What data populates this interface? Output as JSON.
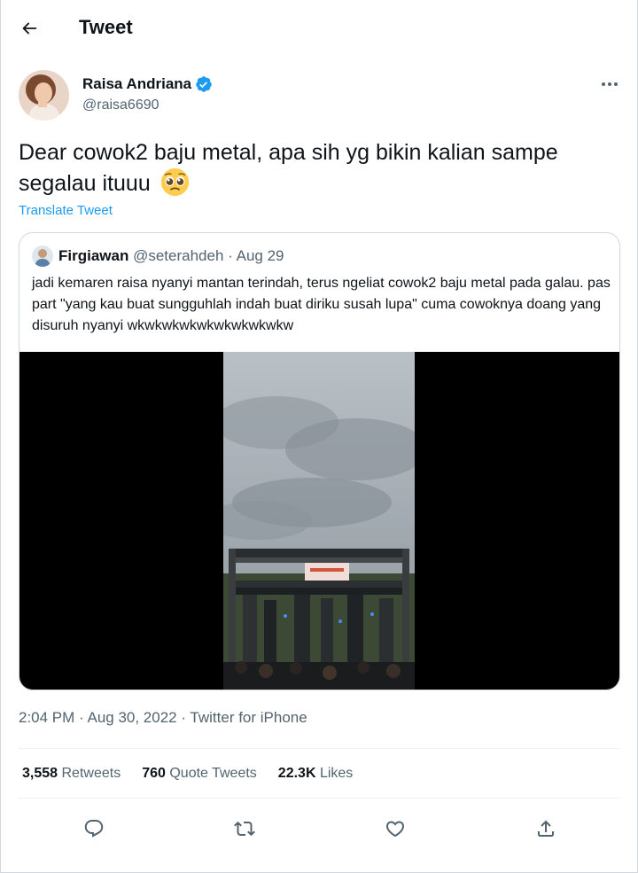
{
  "header": {
    "title": "Tweet"
  },
  "author": {
    "name": "Raisa Andriana",
    "handle": "@raisa6690",
    "verified": true
  },
  "tweet": {
    "text": "Dear cowok2 baju metal, apa sih yg bikin kalian sampe segalau ituuu",
    "emoji": "pleading-face-emoji",
    "translate_label": "Translate Tweet"
  },
  "quoted": {
    "name": "Firgiawan",
    "handle": "@seterahdeh",
    "separator": "·",
    "date": "Aug 29",
    "text": "jadi kemaren raisa nyanyi mantan terindah, terus ngeliat cowok2 baju metal pada galau. pas part \"yang kau buat sungguhlah indah buat diriku susah lupa\" cuma cowoknya doang yang disuruh nyanyi wkwkwkwkwkwkwkwkwkw"
  },
  "meta": {
    "timestamp": "2:04 PM · Aug 30, 2022 · Twitter for iPhone"
  },
  "stats": [
    {
      "count": "3,558",
      "label": "Retweets"
    },
    {
      "count": "760",
      "label": "Quote Tweets"
    },
    {
      "count": "22.3K",
      "label": "Likes"
    }
  ],
  "icons": {
    "back": "arrow-left-icon",
    "more": "more-icon",
    "reply": "reply-icon",
    "retweet": "retweet-icon",
    "like": "heart-icon",
    "share": "share-icon"
  },
  "colors": {
    "accent": "#1d9bf0",
    "secondary_text": "#536471",
    "border": "#cfd9de"
  }
}
